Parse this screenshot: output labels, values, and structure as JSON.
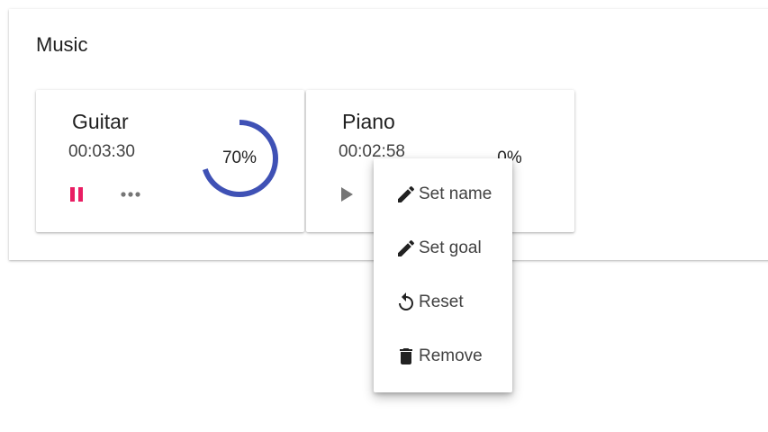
{
  "section": {
    "title": "Music"
  },
  "cards": [
    {
      "name": "Guitar",
      "time": "00:03:30",
      "progress_percent": 70,
      "progress_label": "70%",
      "state": "playing"
    },
    {
      "name": "Piano",
      "time": "00:02:58",
      "progress_percent": 0,
      "progress_label": "0%",
      "state": "paused"
    }
  ],
  "menu": {
    "items": [
      {
        "label": "Set name",
        "icon": "pencil-icon"
      },
      {
        "label": "Set goal",
        "icon": "pencil-icon"
      },
      {
        "label": "Reset",
        "icon": "reset-icon"
      },
      {
        "label": "Remove",
        "icon": "trash-icon"
      }
    ]
  },
  "colors": {
    "progress": "#3f51b5",
    "pause_accent": "#e91e63",
    "icon_gray": "#757575",
    "menu_icon": "#212121"
  }
}
